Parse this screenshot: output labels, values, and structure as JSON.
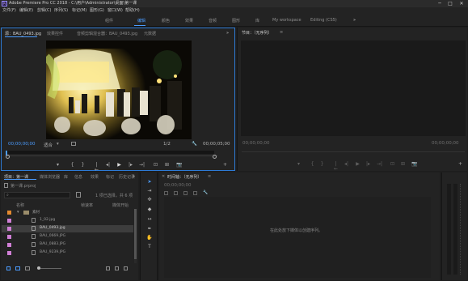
{
  "window": {
    "title": "Adobe Premiere Pro CC 2018 - C:\\用户\\Administrator\\桌面\\第一课",
    "app_badge": "Pr",
    "min": "─",
    "max": "□",
    "close": "✕"
  },
  "menu": [
    "文件(F)",
    "编辑(E)",
    "剪辑(C)",
    "序列(S)",
    "标记(M)",
    "图形(G)",
    "窗口(W)",
    "帮助(H)"
  ],
  "workspaces": [
    "组件",
    "编辑",
    "颜色",
    "效果",
    "音频",
    "图形",
    "库",
    "My workspace",
    "Editing (CS5)"
  ],
  "workspace_active": "编辑",
  "workspace_more": "»",
  "source": {
    "tabs": [
      "源：BAU_0493.jpg",
      "效果控件",
      "音频剪辑混合器：BAU_0493.jpg",
      "元数据"
    ],
    "tab_more": "»",
    "timecode_in": "00;00;00;00",
    "fit": "适合",
    "fit_arrow": "▾",
    "scale": "1/2",
    "timecode_dur": "00;00;05;00",
    "transport": [
      "▾",
      "{",
      "}",
      "|←",
      "◂|",
      "▶",
      "|▸",
      "→|",
      "⊡",
      "⊞",
      "📷",
      "+"
    ]
  },
  "program": {
    "title": "节目：（无序列）",
    "menu_icon": "≡",
    "timecode_in": "00;00;00;00",
    "timecode_out": "00;00;00;00",
    "transport": [
      "▾",
      "{",
      "}",
      "|←",
      "◂|",
      "▶",
      "|▸",
      "→|",
      "⊡",
      "⊞",
      "📷",
      "+"
    ]
  },
  "project": {
    "tabs": [
      "项目：第一课",
      "媒体浏览器",
      "库",
      "信息",
      "效果",
      "标记",
      "历史记录"
    ],
    "tab_more": "»",
    "file": "第一课.prproj",
    "selection": "1 项已选择，共 6 项",
    "columns": {
      "name": "名称",
      "rate": "帧速率",
      "media": "媒体开始"
    },
    "items": [
      {
        "name": "素材",
        "color": "#e38a2f",
        "kind": "folder"
      },
      {
        "name": "1_02.jpg",
        "color": "#d07fd6",
        "kind": "image"
      },
      {
        "name": "BAU_0493.jpg",
        "color": "#d07fd6",
        "kind": "image",
        "selected": true
      },
      {
        "name": "BAU_0669.JPG",
        "color": "#d07fd6",
        "kind": "image"
      },
      {
        "name": "BAU_0883.JPG",
        "color": "#d07fd6",
        "kind": "image"
      },
      {
        "name": "BAU_9239.JPG",
        "color": "#d07fd6",
        "kind": "image"
      }
    ]
  },
  "timeline": {
    "title": "时间轴：（无序列）",
    "menu_icon": "≡",
    "timecode": "00;00;00;00",
    "empty_hint": "在此处放下媒体以创建序列。"
  },
  "colors": {
    "accent": "#4b9cff",
    "folder": "#e38a2f",
    "image_label": "#d07fd6"
  }
}
